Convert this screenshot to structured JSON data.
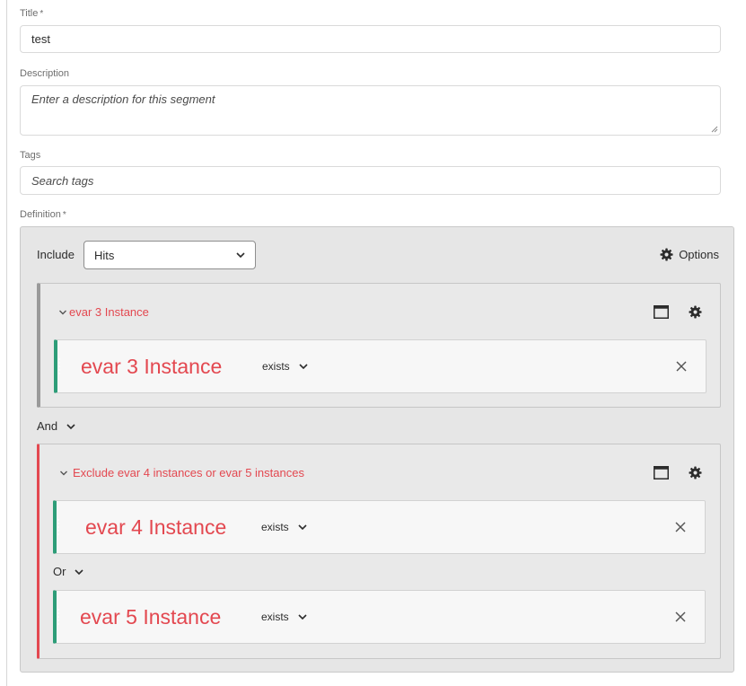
{
  "form": {
    "title_label": "Title",
    "required_mark": "*",
    "title_value": "test",
    "description_label": "Description",
    "description_placeholder": "Enter a description for this segment",
    "tags_label": "Tags",
    "tags_placeholder": "Search tags",
    "definition_label": "Definition"
  },
  "definition": {
    "include_label": "Include",
    "scope_selected": "Hits",
    "options_label": "Options",
    "containers": [
      {
        "title": "evar 3 Instance",
        "rules": [
          {
            "name": "evar 3 Instance",
            "operator": "exists"
          }
        ]
      },
      {
        "title": "Exclude evar 4 instances or evar 5 instances",
        "rules": [
          {
            "name": "evar 4 Instance",
            "operator": "exists"
          },
          {
            "name": "evar 5 Instance",
            "operator": "exists"
          }
        ],
        "inner_logic": "Or"
      }
    ],
    "between_logic": "And"
  },
  "colors": {
    "accent_red": "#e34850",
    "rule_green": "#2d9d78"
  },
  "icons": [
    "gear-icon",
    "chevron-down-icon",
    "panel-icon",
    "close-icon",
    "drag-handle-icon"
  ]
}
